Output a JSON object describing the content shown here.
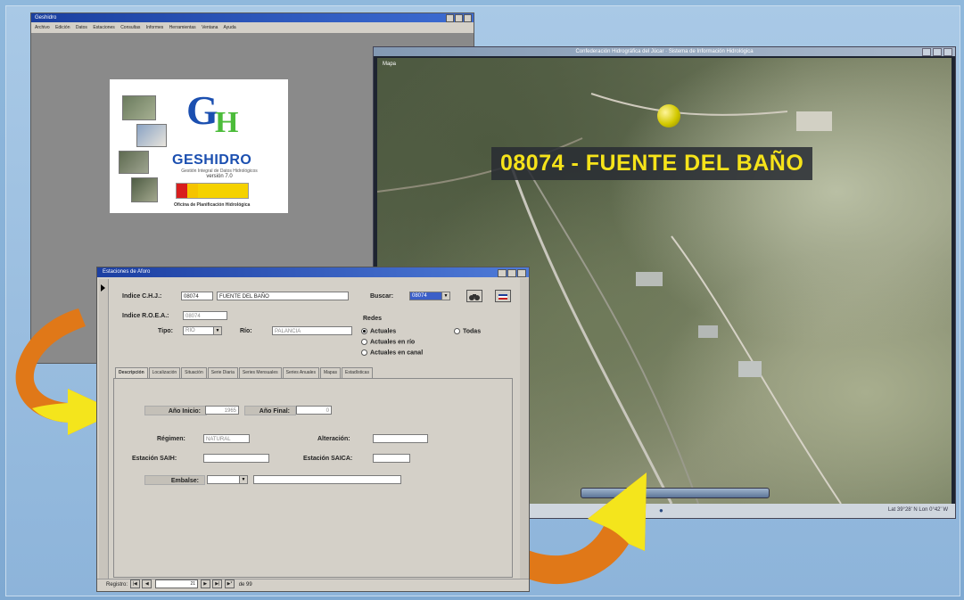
{
  "splash_window": {
    "title": "Geshidro",
    "menu": [
      "Archivo",
      "Edición",
      "Datos",
      "Estaciones",
      "Consultas",
      "Informes",
      "Herramientas",
      "Ventana",
      "Ayuda"
    ],
    "logo_name": "GESHIDRO",
    "logo_sub": "Gestión Integral de Datos Hidrológicos",
    "version": "versión 7.0",
    "office": "Oficina de Planificación Hidrológica"
  },
  "map_window": {
    "title": "Confederación Hidrográfica del Júcar · Sistema de Información Hidrológica",
    "map_tag": "Mapa",
    "station_label": "08074 - FUENTE DEL BAÑO",
    "status_coords": "Lat 39°28' N  Lon 0°42' W"
  },
  "form": {
    "title": "Estaciones de Aforo",
    "indice_chj_label": "Indice C.H.J.:",
    "indice_chj_code": "08074",
    "indice_chj_name": "FUENTE DEL BAÑO",
    "indice_roea_label": "Indice R.O.E.A.:",
    "indice_roea_value": "08074",
    "tipo_label": "Tipo:",
    "tipo_value": "RIO",
    "rio_label": "Río:",
    "rio_value": "PALANCIA",
    "buscar_label": "Buscar:",
    "buscar_value": "08074",
    "redes_title": "Redes",
    "radios": [
      {
        "label": "Actuales",
        "checked": true
      },
      {
        "label": "Todas",
        "checked": false
      },
      {
        "label": "Actuales en río",
        "checked": false
      },
      {
        "label": "Actuales en canal",
        "checked": false
      }
    ],
    "tabs": [
      "Descripción",
      "Localización",
      "Situación",
      "Serie Diaria",
      "Series Mensuales",
      "Series Anuales",
      "Mapas",
      "Estadísticas"
    ],
    "anio_inicio_label": "Año Inicio:",
    "anio_inicio_value": "1965",
    "anio_final_label": "Año Final:",
    "anio_final_value": "0",
    "regimen_label": "Régimen:",
    "regimen_value": "NATURAL",
    "alteracion_label": "Alteración:",
    "alteracion_value": "",
    "estacion_saih_label": "Estación SAIH:",
    "estacion_saih_value": "",
    "estacion_saica_label": "Estación SAICA:",
    "estacion_saica_value": "",
    "embalse_label": "Embalse:",
    "embalse_value": "",
    "embalse_desc": "",
    "nav_label": "Registro:",
    "nav_current": "21",
    "nav_total": "de 99"
  },
  "colors": {
    "station_label_text": "#f6e31a",
    "arrow_orange": "#e07818",
    "arrow_yellow": "#f4e51c"
  }
}
